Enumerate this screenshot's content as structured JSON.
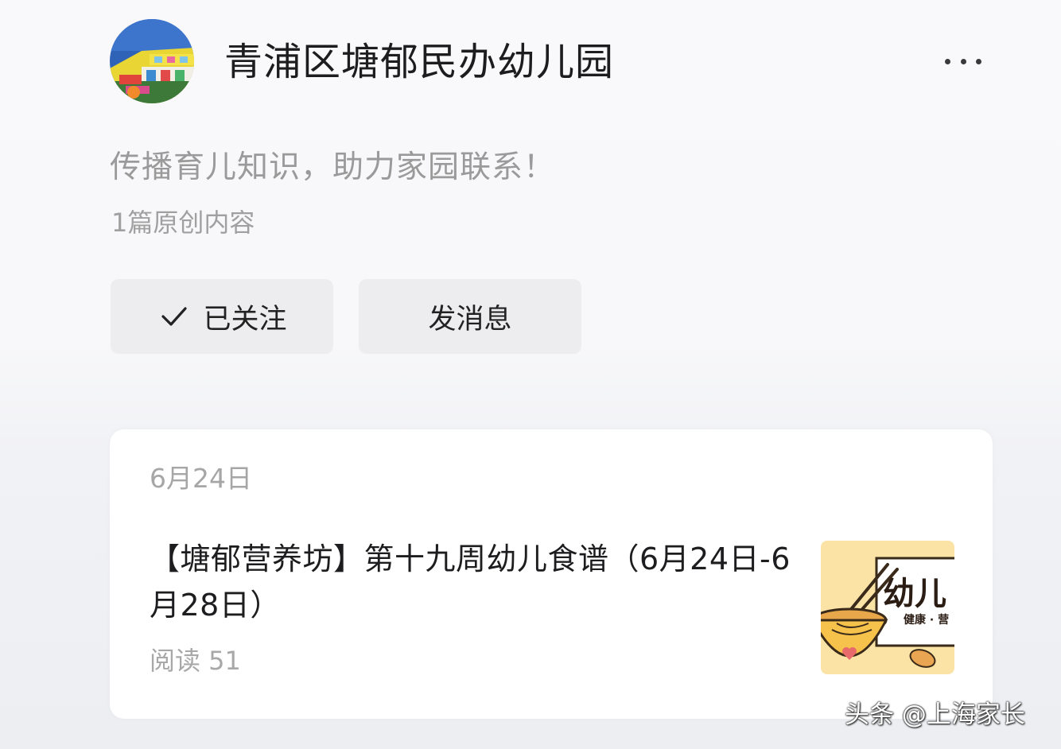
{
  "account": {
    "name": "青浦区塘郁民办幼儿园",
    "description": "传播育儿知识，助力家园联系！",
    "original_count": "1篇原创内容",
    "avatar_icon": "kindergarten-building-photo",
    "more_icon": "more-dots-icon"
  },
  "actions": {
    "follow_label": "已关注",
    "follow_icon": "checkmark-icon",
    "message_label": "发消息"
  },
  "article": {
    "date": "6月24日",
    "title": "【塘郁营养坊】第十九周幼儿食谱（6月24日-6月28日）",
    "reads": "阅读 51",
    "thumbnail": {
      "text_large": "幼儿",
      "text_small": "健康 · 营",
      "icon": "noodle-bowl-illustration"
    }
  },
  "watermark": "头条 @上海家长",
  "colors": {
    "title": "#1d1d1f",
    "secondary_text": "#9a9a9a",
    "button_bg": "#ededf0",
    "card_bg": "#ffffff",
    "thumb_bg": "#fbe3a6"
  }
}
